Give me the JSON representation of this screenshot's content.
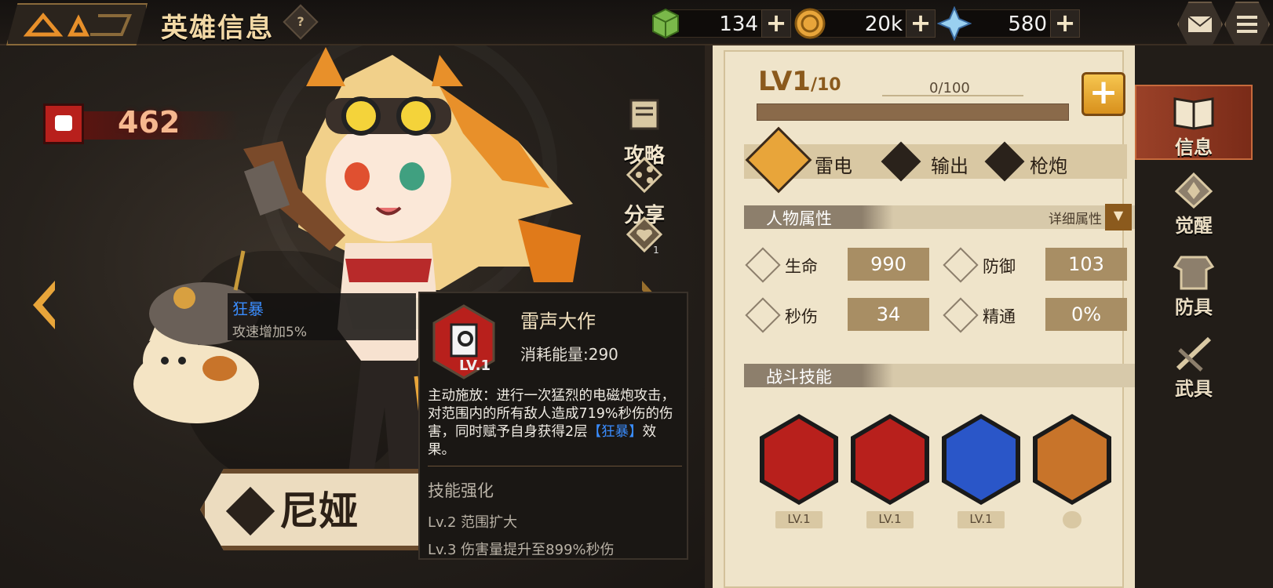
{
  "header": {
    "title": "英雄信息",
    "help_label": "?"
  },
  "resources": [
    {
      "name": "stamina",
      "icon": "green-cube-icon",
      "value": "134"
    },
    {
      "name": "gold",
      "icon": "gold-coin-icon",
      "value": "20k"
    },
    {
      "name": "crystal",
      "icon": "crystal-icon",
      "value": "580"
    }
  ],
  "power": {
    "value": "462"
  },
  "side_buttons": {
    "guide": "攻略",
    "share": "分享",
    "affection_count": "1"
  },
  "hero": {
    "name": "尼娅"
  },
  "buff": {
    "name": "狂暴",
    "desc": "攻速增加5%"
  },
  "skill_tooltip": {
    "title": "雷声大作",
    "level": "LV.1",
    "cost": "消耗能量:290",
    "desc_part1": "主动施放：进行一次猛烈的电磁炮攻击，对范围内的所有敌人造成719%秒伤的伤害，同时赋予自身获得2层",
    "desc_highlight": "【狂暴】",
    "desc_part2": "效果。",
    "enhance_title": "技能强化",
    "upgrades": [
      "Lv.2  范围扩大",
      "Lv.3  伤害量提升至899%秒伤"
    ]
  },
  "level": {
    "current": "LV1",
    "max": "/10",
    "exp_text": "0/100",
    "exp_progress": 0
  },
  "tags": [
    {
      "icon": "lightning-icon",
      "label": "雷电"
    },
    {
      "icon": "output-icon",
      "label": "输出"
    },
    {
      "icon": "gun-icon",
      "label": "枪炮"
    }
  ],
  "attributes": {
    "title": "人物属性",
    "detail_label": "详细属性",
    "stats": [
      {
        "icon": "heart-icon",
        "label": "生命",
        "value": "990"
      },
      {
        "icon": "shield-icon",
        "label": "防御",
        "value": "103"
      },
      {
        "icon": "dps-icon",
        "label": "秒伤",
        "value": "34"
      },
      {
        "icon": "mastery-icon",
        "label": "精通",
        "value": "0%"
      }
    ]
  },
  "combat_skills": {
    "title": "战斗技能",
    "skills": [
      {
        "icon": "railgun-skill-icon",
        "level": "LV.1",
        "color": "#b8201c"
      },
      {
        "icon": "claw-skill-icon",
        "level": "LV.1",
        "color": "#b8201c"
      },
      {
        "icon": "paw-lightning-skill-icon",
        "level": "LV.1",
        "color": "#2a56c8"
      },
      {
        "icon": "axe-skill-icon",
        "level": "",
        "color": "#c8742a"
      }
    ]
  },
  "tabs": [
    {
      "icon": "book-icon",
      "label": "信息",
      "active": true
    },
    {
      "icon": "awaken-icon",
      "label": "觉醒",
      "active": false
    },
    {
      "icon": "armor-icon",
      "label": "防具",
      "active": false
    },
    {
      "icon": "weapon-icon",
      "label": "武具",
      "active": false
    }
  ],
  "colors": {
    "accent_gold": "#e9b54d",
    "panel_bg": "#efe4ca",
    "active_tab": "#9a4128",
    "highlight_blue": "#3a8dff"
  }
}
